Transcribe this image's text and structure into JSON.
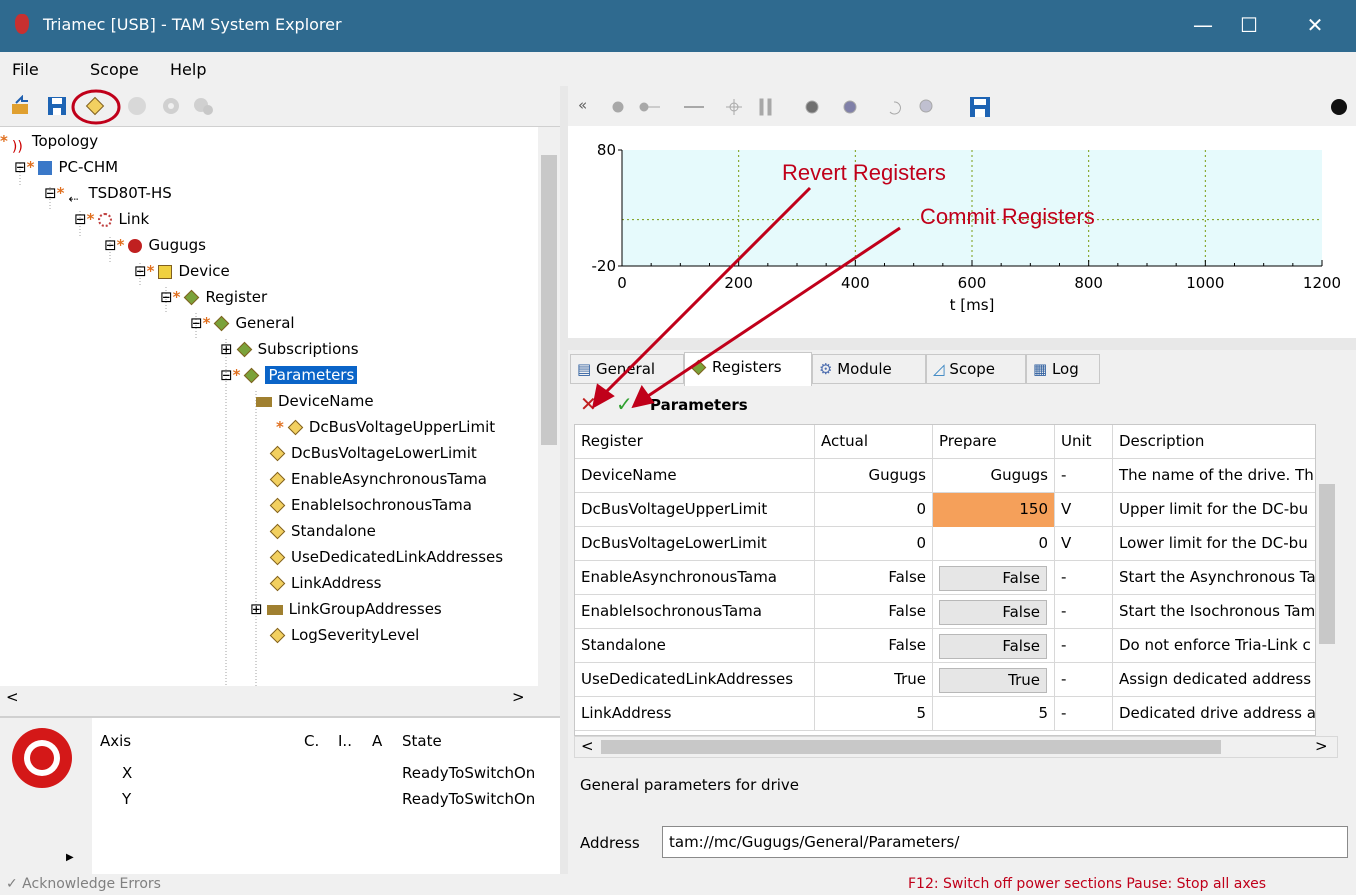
{
  "window": {
    "title": "Triamec [USB] - TAM System Explorer",
    "minimize": "—",
    "maximize": "☐",
    "close": "✕"
  },
  "menu": {
    "file": "File",
    "scope": "Scope",
    "help": "Help"
  },
  "tree": {
    "items": [
      {
        "label": "Topology"
      },
      {
        "label": "PC-CHM"
      },
      {
        "label": "TSD80T-HS"
      },
      {
        "label": "Link"
      },
      {
        "label": "Gugugs"
      },
      {
        "label": "Device"
      },
      {
        "label": "Register"
      },
      {
        "label": "General"
      },
      {
        "label": "Subscriptions"
      },
      {
        "label": "Parameters"
      },
      {
        "label": "DeviceName"
      },
      {
        "label": "DcBusVoltageUpperLimit"
      },
      {
        "label": "DcBusVoltageLowerLimit"
      },
      {
        "label": "EnableAsynchronousTama"
      },
      {
        "label": "EnableIsochronousTama"
      },
      {
        "label": "Standalone"
      },
      {
        "label": "UseDedicatedLinkAddresses"
      },
      {
        "label": "LinkAddress"
      },
      {
        "label": "LinkGroupAddresses"
      },
      {
        "label": "LogSeverityLevel"
      }
    ],
    "star": "*"
  },
  "axis": {
    "headers": {
      "axis": "Axis",
      "c": "C.",
      "i": "I..",
      "a": "A",
      "state": "State"
    },
    "rows": [
      {
        "axis": "X",
        "state": "ReadyToSwitchOn"
      },
      {
        "axis": "Y",
        "state": "ReadyToSwitchOn"
      }
    ]
  },
  "status": {
    "ack": "✓ Acknowledge Errors",
    "hint": "F12: Switch off power sections  Pause: Stop all axes"
  },
  "scope": {
    "collapse": "«",
    "y_ticks": [
      "80",
      "-20"
    ],
    "x_ticks": [
      "0",
      "200",
      "400",
      "600",
      "800",
      "1000",
      "1200"
    ],
    "xlabel": "t [ms]"
  },
  "chart_data": {
    "type": "line",
    "xlabel": "t [ms]",
    "ylabel": "",
    "xlim": [
      0,
      1200
    ],
    "ylim": [
      -20,
      80
    ],
    "series": [],
    "grid": true,
    "x_ticks": [
      0,
      200,
      400,
      600,
      800,
      1000,
      1200
    ],
    "y_ticks": [
      -20,
      80
    ]
  },
  "annotations": {
    "revert": "Revert Registers",
    "commit": "Commit Registers",
    "color": "#c0001a"
  },
  "tabs": [
    {
      "label": "General"
    },
    {
      "label": "Registers"
    },
    {
      "label": "Module"
    },
    {
      "label": "Scope"
    },
    {
      "label": "Log"
    }
  ],
  "registers": {
    "header": "Parameters",
    "revert_icon": "✕",
    "commit_icon": "✓",
    "columns": [
      "Register",
      "Actual",
      "Prepare",
      "Unit",
      "Description"
    ],
    "rows": [
      {
        "register": "DeviceName",
        "actual": "Gugugs",
        "prepare": "Gugugs",
        "unit": "-",
        "description": "The name of the drive. Th"
      },
      {
        "register": "DcBusVoltageUpperLimit",
        "actual": "0",
        "prepare": "150",
        "unit": "V",
        "description": "Upper limit for the DC-bu"
      },
      {
        "register": "DcBusVoltageLowerLimit",
        "actual": "0",
        "prepare": "0",
        "unit": "V",
        "description": "Lower limit for the DC-bu"
      },
      {
        "register": "EnableAsynchronousTama",
        "actual": "False",
        "prepare": "False",
        "unit": "-",
        "description": "Start the Asynchronous Ta"
      },
      {
        "register": "EnableIsochronousTama",
        "actual": "False",
        "prepare": "False",
        "unit": "-",
        "description": "Start the Isochronous Tam"
      },
      {
        "register": "Standalone",
        "actual": "False",
        "prepare": "False",
        "unit": "-",
        "description": "Do not enforce Tria-Link c"
      },
      {
        "register": "UseDedicatedLinkAddresses",
        "actual": "True",
        "prepare": "True",
        "unit": "-",
        "description": "Assign dedicated address"
      },
      {
        "register": "LinkAddress",
        "actual": "5",
        "prepare": "5",
        "unit": "-",
        "description": "Dedicated drive address a"
      }
    ],
    "description": "General parameters for drive",
    "address_label": "Address",
    "address_value": "tam://mc/Gugugs/General/Parameters/"
  },
  "colors": {
    "titlebar": "#2f6a8f",
    "selection": "#0a64c8",
    "modified": "#f5a05a",
    "annotation": "#c0001a"
  }
}
